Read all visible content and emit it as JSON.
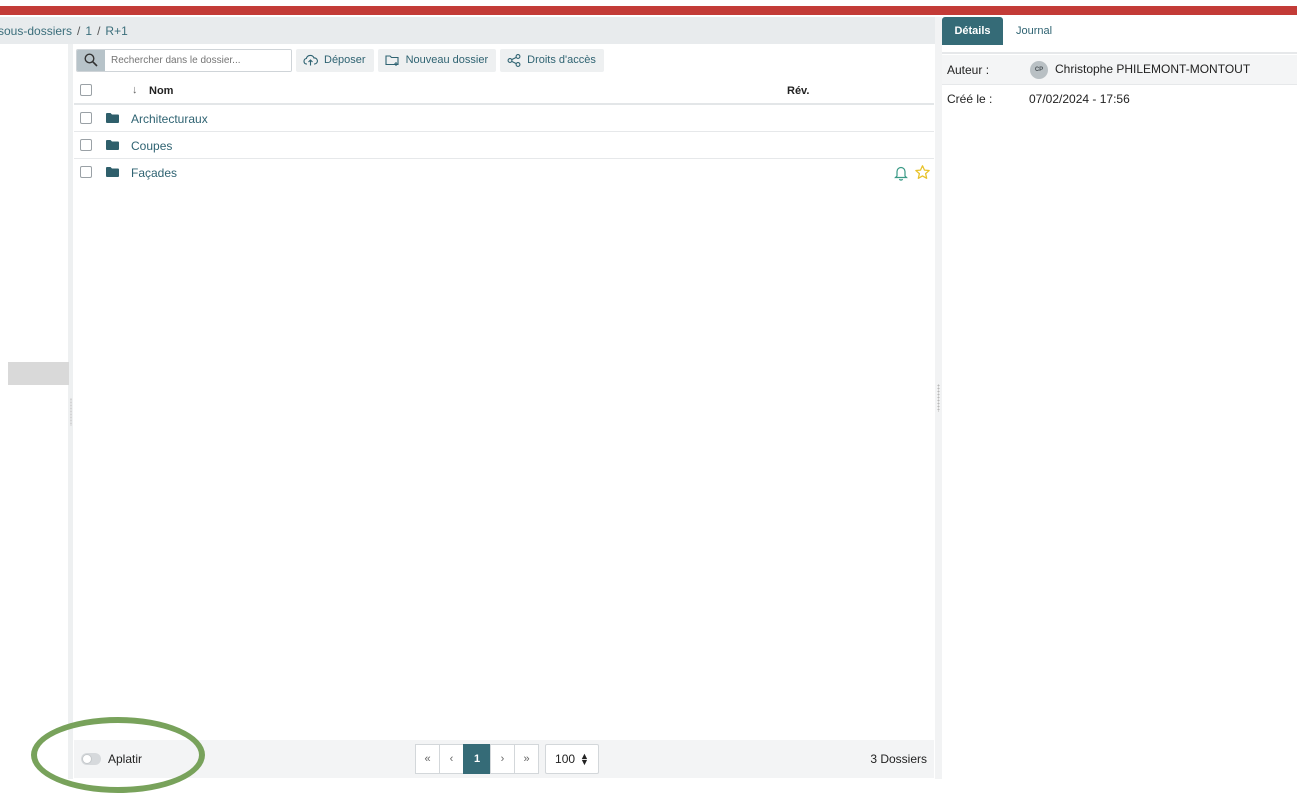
{
  "breadcrumb": {
    "items": [
      "sous-dossiers",
      "1",
      "R+1"
    ],
    "separator": "/"
  },
  "toolbar": {
    "search_placeholder": "Rechercher dans le dossier...",
    "upload_label": "Déposer",
    "new_folder_label": "Nouveau dossier",
    "access_rights_label": "Droits d'accès"
  },
  "table": {
    "columns": {
      "name": "Nom",
      "revision": "Rév."
    },
    "sort_indicator": "↓",
    "rows": [
      {
        "name": "Architecturaux",
        "icon": "folder-icon"
      },
      {
        "name": "Coupes",
        "icon": "folder-icon"
      },
      {
        "name": "Façades",
        "icon": "folder-icon",
        "notification": true,
        "favorite": true
      }
    ]
  },
  "footer": {
    "flatten_label": "Aplatir",
    "flatten_enabled": false,
    "pagination": {
      "first": "«",
      "prev": "‹",
      "current": "1",
      "next": "›",
      "last": "»"
    },
    "per_page": "100",
    "count_label": "3 Dossiers"
  },
  "details_panel": {
    "tabs": [
      "Détails",
      "Journal"
    ],
    "active_tab": "Détails",
    "author_label": "Auteur :",
    "author_initials": "CP",
    "author_name": "Christophe PHILEMONT-MONTOUT",
    "created_label": "Créé le :",
    "created_value": "07/02/2024 - 17:56"
  },
  "colors": {
    "top_bar": "#c33b37",
    "accent": "#356b77",
    "link": "#2f6372",
    "highlight": "#78a25b",
    "star": "#e8c229"
  }
}
